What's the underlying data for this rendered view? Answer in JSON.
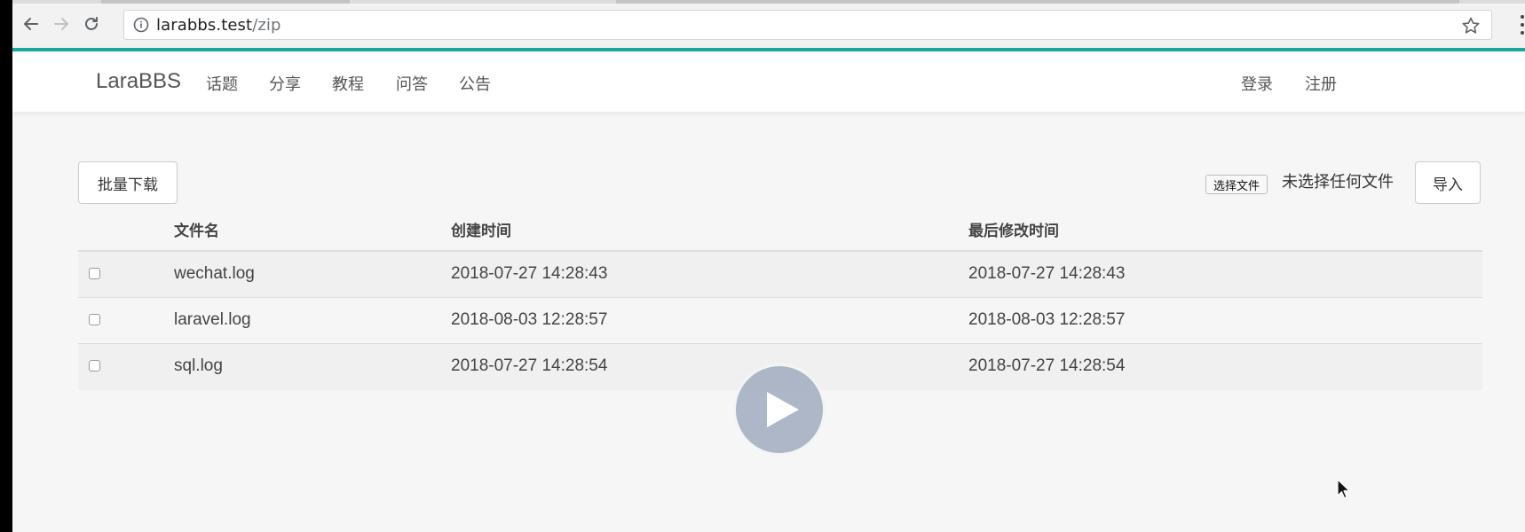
{
  "browser": {
    "url_host": "larabbs.test",
    "url_path": "/zip"
  },
  "navbar": {
    "brand": "LaraBBS",
    "links": [
      "话题",
      "分享",
      "教程",
      "问答",
      "公告"
    ],
    "login": "登录",
    "register": "注册"
  },
  "toolbar": {
    "batch_download": "批量下载",
    "choose_file": "选择文件",
    "file_status": "未选择任何文件",
    "import": "导入"
  },
  "table": {
    "headers": [
      "文件名",
      "创建时间",
      "最后修改时间"
    ],
    "rows": [
      {
        "name": "wechat.log",
        "created": "2018-07-27 14:28:43",
        "modified": "2018-07-27 14:28:43",
        "checked": false
      },
      {
        "name": "laravel.log",
        "created": "2018-08-03 12:28:57",
        "modified": "2018-08-03 12:28:57",
        "checked": false
      },
      {
        "name": "sql.log",
        "created": "2018-07-27 14:28:54",
        "modified": "2018-07-27 14:28:54",
        "checked": false
      }
    ]
  },
  "icons": {
    "back": "arrow-left-icon",
    "forward": "arrow-right-icon",
    "reload": "reload-icon",
    "info": "info-icon",
    "bookmark": "star-icon",
    "menu": "kebab-menu-icon",
    "play": "play-icon",
    "cursor": "mouse-cursor-icon"
  },
  "colors": {
    "accent": "#1aa99a",
    "page_background": "#f6f6f6",
    "navbar_background": "#ffffff",
    "play_overlay": "#a0acbe"
  }
}
